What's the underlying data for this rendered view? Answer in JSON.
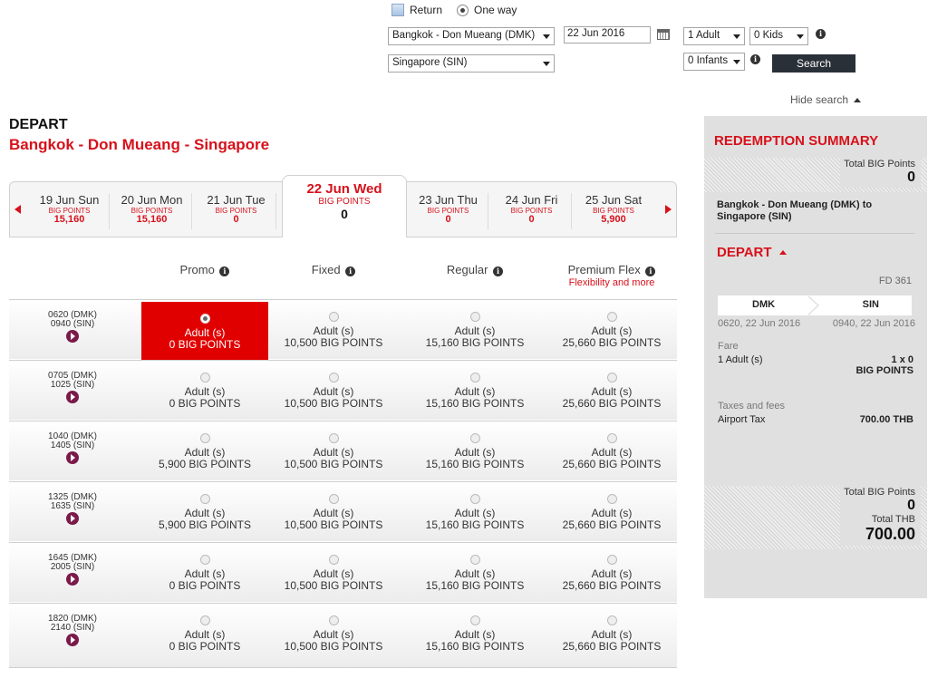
{
  "search": {
    "return_label": "Return",
    "oneway_label": "One way",
    "origin": "Bangkok - Don Mueang (DMK)",
    "destination": "Singapore (SIN)",
    "date": "22 Jun 2016",
    "adults": "1 Adult",
    "kids": "0 Kids",
    "infants": "0 Infants",
    "search_button": "Search",
    "hide_search": "Hide search"
  },
  "header": {
    "depart": "DEPART",
    "route": "Bangkok - Don Mueang - Singapore"
  },
  "dates": [
    {
      "date": "19 Jun Sun",
      "label": "BIG POINTS",
      "points": "15,160"
    },
    {
      "date": "20 Jun Mon",
      "label": "BIG POINTS",
      "points": "15,160"
    },
    {
      "date": "21 Jun Tue",
      "label": "BIG POINTS",
      "points": "0"
    },
    {
      "date": "22 Jun Wed",
      "label": "BIG POINTS",
      "points": "0"
    },
    {
      "date": "23 Jun Thu",
      "label": "BIG POINTS",
      "points": "0"
    },
    {
      "date": "24 Jun Fri",
      "label": "BIG POINTS",
      "points": "0"
    },
    {
      "date": "25 Jun Sat",
      "label": "BIG POINTS",
      "points": "5,900"
    }
  ],
  "columns": [
    {
      "label": "Promo",
      "sub": ""
    },
    {
      "label": "Fixed",
      "sub": ""
    },
    {
      "label": "Regular",
      "sub": ""
    },
    {
      "label": "Premium Flex",
      "sub": "Flexibility and more"
    }
  ],
  "flights": [
    {
      "dep": "0620 (DMK)",
      "arr": "0940 (SIN)",
      "fares": [
        {
          "pax": "Adult (s)",
          "pts": "0 BIG POINTS"
        },
        {
          "pax": "Adult (s)",
          "pts": "10,500 BIG POINTS"
        },
        {
          "pax": "Adult (s)",
          "pts": "15,160 BIG POINTS"
        },
        {
          "pax": "Adult (s)",
          "pts": "25,660 BIG POINTS"
        }
      ]
    },
    {
      "dep": "0705 (DMK)",
      "arr": "1025 (SIN)",
      "fares": [
        {
          "pax": "Adult (s)",
          "pts": "0 BIG POINTS"
        },
        {
          "pax": "Adult (s)",
          "pts": "10,500 BIG POINTS"
        },
        {
          "pax": "Adult (s)",
          "pts": "15,160 BIG POINTS"
        },
        {
          "pax": "Adult (s)",
          "pts": "25,660 BIG POINTS"
        }
      ]
    },
    {
      "dep": "1040 (DMK)",
      "arr": "1405 (SIN)",
      "fares": [
        {
          "pax": "Adult (s)",
          "pts": "5,900 BIG POINTS"
        },
        {
          "pax": "Adult (s)",
          "pts": "10,500 BIG POINTS"
        },
        {
          "pax": "Adult (s)",
          "pts": "15,160 BIG POINTS"
        },
        {
          "pax": "Adult (s)",
          "pts": "25,660 BIG POINTS"
        }
      ]
    },
    {
      "dep": "1325 (DMK)",
      "arr": "1635 (SIN)",
      "fares": [
        {
          "pax": "Adult (s)",
          "pts": "5,900 BIG POINTS"
        },
        {
          "pax": "Adult (s)",
          "pts": "10,500 BIG POINTS"
        },
        {
          "pax": "Adult (s)",
          "pts": "15,160 BIG POINTS"
        },
        {
          "pax": "Adult (s)",
          "pts": "25,660 BIG POINTS"
        }
      ]
    },
    {
      "dep": "1645 (DMK)",
      "arr": "2005 (SIN)",
      "fares": [
        {
          "pax": "Adult (s)",
          "pts": "0 BIG POINTS"
        },
        {
          "pax": "Adult (s)",
          "pts": "10,500 BIG POINTS"
        },
        {
          "pax": "Adult (s)",
          "pts": "15,160 BIG POINTS"
        },
        {
          "pax": "Adult (s)",
          "pts": "25,660 BIG POINTS"
        }
      ]
    },
    {
      "dep": "1820 (DMK)",
      "arr": "2140 (SIN)",
      "fares": [
        {
          "pax": "Adult (s)",
          "pts": "0 BIG POINTS"
        },
        {
          "pax": "Adult (s)",
          "pts": "10,500 BIG POINTS"
        },
        {
          "pax": "Adult (s)",
          "pts": "15,160 BIG POINTS"
        },
        {
          "pax": "Adult (s)",
          "pts": "25,660 BIG POINTS"
        }
      ]
    }
  ],
  "summary": {
    "title": "REDEMPTION SUMMARY",
    "total_points_label": "Total BIG Points",
    "total_points": "0",
    "route": "Bangkok - Don Mueang (DMK) to Singapore (SIN)",
    "depart": "DEPART",
    "flight_no": "FD 361",
    "origin": "DMK",
    "dest": "SIN",
    "dep_time": "0620, 22 Jun 2016",
    "arr_time": "0940, 22 Jun 2016",
    "fare_label": "Fare",
    "fare_pax": "1 Adult (s)",
    "fare_value": "1 x 0",
    "fare_unit": "BIG POINTS",
    "taxes_label": "Taxes and fees",
    "tax_name": "Airport Tax",
    "tax_value": "700.00 THB",
    "bottom_points_label": "Total BIG Points",
    "bottom_points": "0",
    "total_thb_label": "Total THB",
    "total_thb": "700.00"
  },
  "colors": {
    "brand_red": "#d7111b",
    "selected_cell": "#e10000",
    "dark_button": "#2a3038"
  }
}
